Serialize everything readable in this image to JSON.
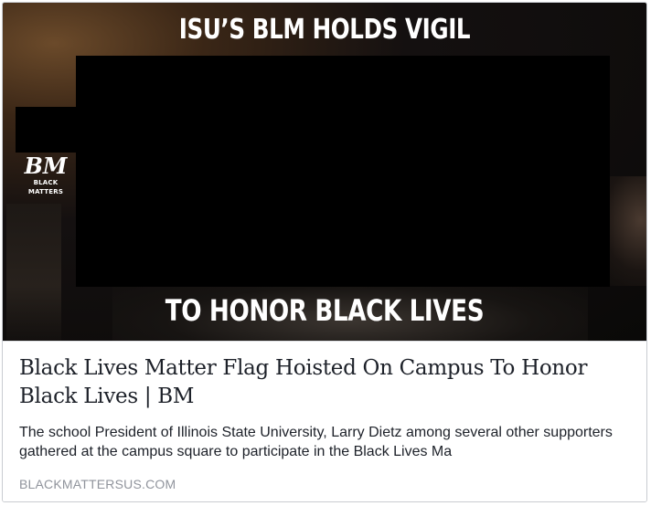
{
  "link_preview": {
    "image": {
      "headline_top": "ISU’S BLM HOLDS VIGIL",
      "headline_bottom": "TO HONOR BLACK LIVES",
      "logo": {
        "mark": "BM",
        "text": "BLACK MATTERS"
      }
    },
    "title": "Black Lives Matter Flag Hoisted On Campus To Honor Black Lives | BM",
    "description": "The school President of Illinois State University, Larry Dietz among several other supporters gathered at the campus square to participate in the Black Lives Ma",
    "domain": "BLACKMATTERSUS.COM"
  },
  "colors": {
    "title_text": "#1d2129",
    "domain_text": "#90949c",
    "card_border": "#c9ccd1",
    "redaction": "#000000"
  }
}
